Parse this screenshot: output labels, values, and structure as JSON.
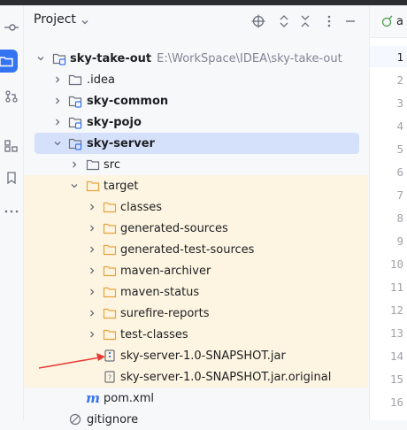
{
  "panel": {
    "title": "Project"
  },
  "tree": [
    {
      "label": "sky-take-out",
      "path": "E:\\WorkSpace\\IDEA\\sky-take-out"
    },
    {
      "label": ".idea"
    },
    {
      "label": "sky-common"
    },
    {
      "label": "sky-pojo"
    },
    {
      "label": "sky-server"
    },
    {
      "label": "src"
    },
    {
      "label": "target"
    },
    {
      "label": "classes"
    },
    {
      "label": "generated-sources"
    },
    {
      "label": "generated-test-sources"
    },
    {
      "label": "maven-archiver"
    },
    {
      "label": "maven-status"
    },
    {
      "label": "surefire-reports"
    },
    {
      "label": "test-classes"
    },
    {
      "label": "sky-server-1.0-SNAPSHOT.jar"
    },
    {
      "label": "sky-server-1.0-SNAPSHOT.jar.original"
    },
    {
      "label": "pom.xml"
    },
    {
      "label": "gitignore"
    }
  ],
  "editor": {
    "tab_label": "a",
    "line_numbers": [
      "1",
      "2",
      "3",
      "4",
      "5",
      "6",
      "7",
      "8",
      "9",
      "10",
      "11",
      "12",
      "13",
      "14",
      "15",
      "16"
    ]
  },
  "colors": {
    "folder": "#e8a33d",
    "module": "#3574f0",
    "selected": "#d5e1fb",
    "excluded_bg": "#fdf5e1",
    "arrow": "#e53935"
  }
}
